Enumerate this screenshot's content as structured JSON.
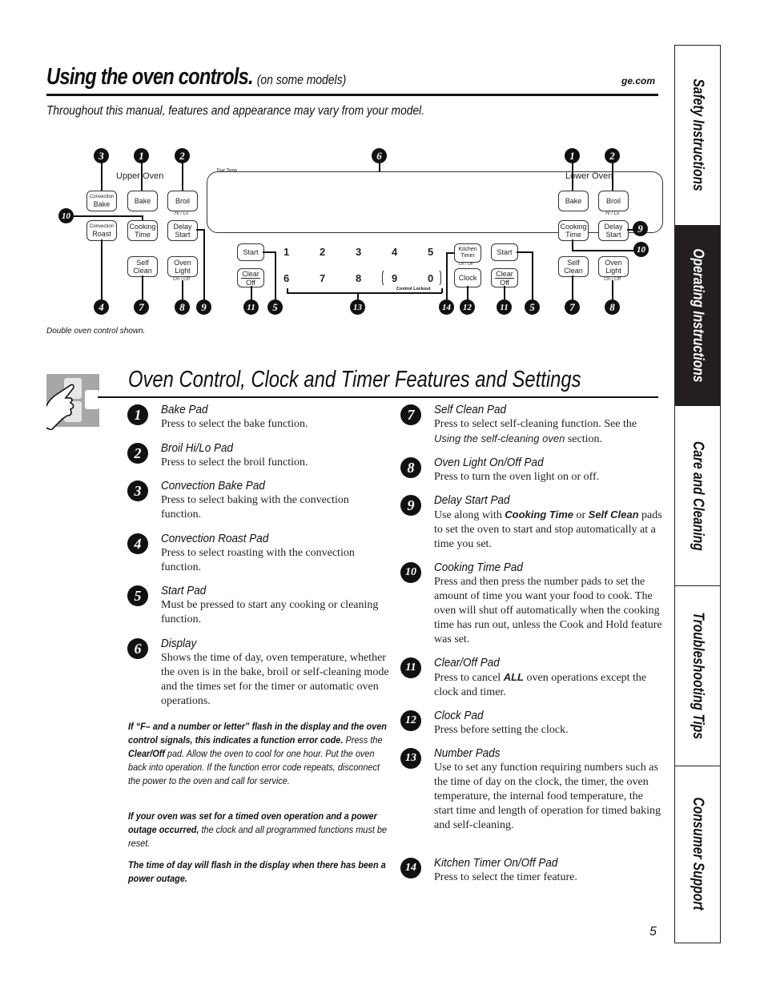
{
  "header": {
    "title": "Using the oven controls.",
    "title_sub": "(on some models)",
    "site": "ge.com",
    "intro": "Throughout this manual, features and appearance may vary from your model."
  },
  "diagram": {
    "upper_oven_label": "Upper Oven",
    "lower_oven_label": "Lower Oven",
    "display_label": "True Temp",
    "control_lockout_label": "Control Lockout",
    "pads": {
      "convection_bake_small": "Convection",
      "convection_bake": "Bake",
      "bake": "Bake",
      "broil": "Broil",
      "broil_sub": "Hi / Lo",
      "convection_roast_small": "Convection",
      "convection_roast": "Roast",
      "cooking_time_1": "Cooking",
      "cooking_time_2": "Time",
      "delay_start_1": "Delay",
      "delay_start_2": "Start",
      "self_clean_1": "Self",
      "self_clean_2": "Clean",
      "oven_light_1": "Oven",
      "oven_light_2": "Light",
      "oven_light_sub": "On / Off",
      "start": "Start",
      "clear": "Clear",
      "off": "Off",
      "kitchen_timer_1": "Kitchen",
      "kitchen_timer_2": "Timer",
      "kitchen_timer_sub": "On / Off",
      "clock": "Clock"
    },
    "number_pads": [
      "1",
      "2",
      "3",
      "4",
      "5",
      "6",
      "7",
      "8",
      "9",
      "0"
    ],
    "callouts": {
      "c1": "1",
      "c2": "2",
      "c3": "3",
      "c4": "4",
      "c5": "5",
      "c6": "6",
      "c7": "7",
      "c8": "8",
      "c9": "9",
      "c10": "10",
      "c11": "11",
      "c12": "12",
      "c13": "13",
      "c14": "14"
    },
    "caption": "Double oven control shown."
  },
  "section": {
    "title": "Oven Control, Clock and Timer Features and Settings"
  },
  "features": [
    {
      "num": "1",
      "title": "Bake Pad",
      "desc": "Press to select the bake function."
    },
    {
      "num": "2",
      "title": "Broil Hi/Lo Pad",
      "desc": "Press to select the broil function."
    },
    {
      "num": "3",
      "title": "Convection Bake Pad",
      "desc": "Press to select baking with the convection function."
    },
    {
      "num": "4",
      "title": "Convection Roast Pad",
      "desc": "Press to select roasting with the convection function."
    },
    {
      "num": "5",
      "title": "Start Pad",
      "desc": "Must be pressed to start any cooking or cleaning function."
    },
    {
      "num": "6",
      "title": "Display",
      "desc": "Shows the time of day, oven temperature, whether the oven is in the bake, broil or self-cleaning mode and the times set for the timer or automatic oven operations."
    },
    {
      "num": "7",
      "title": "Self Clean Pad",
      "desc_pre": "Press to select self-cleaning function. See the ",
      "desc_em": "Using the self-cleaning oven",
      "desc_post": " section."
    },
    {
      "num": "8",
      "title": "Oven Light On/Off Pad",
      "desc": "Press to turn the oven light on or off."
    },
    {
      "num": "9",
      "title": "Delay Start Pad",
      "desc_pre": "Use along with ",
      "desc_b1": "Cooking Time",
      "desc_mid": " or ",
      "desc_b2": "Self Clean",
      "desc_post": " pads to set the oven to start and stop automatically at a time you set."
    },
    {
      "num": "10",
      "title": "Cooking Time Pad",
      "desc": "Press and then press the number pads to set the amount of time you want your food to cook. The oven will shut off automatically when the cooking time has run out, unless the Cook and Hold feature was set."
    },
    {
      "num": "11",
      "title": "Clear/Off Pad",
      "desc_pre": "Press to cancel ",
      "desc_b1": "ALL",
      "desc_post": " oven operations except the clock and timer."
    },
    {
      "num": "12",
      "title": "Clock Pad",
      "desc": "Press before setting the clock."
    },
    {
      "num": "13",
      "title": "Number Pads",
      "desc": "Use to set any function requiring numbers such as the time of day on the clock, the timer, the oven temperature, the internal food temperature, the start time and length of operation for timed baking and self-cleaning."
    },
    {
      "num": "14",
      "title": "Kitchen Timer On/Off Pad",
      "desc": "Press to select the timer feature."
    }
  ],
  "notes": {
    "n1_bold": "If “F– and a number or letter” flash in the display and the oven control signals, this indicates a function error code.",
    "n1_text_a": " Press the ",
    "n1_bold2": "Clear/Off",
    "n1_text_b": " pad. Allow the oven to cool for one hour. Put the oven back into operation. If the function error code repeats, disconnect the power to the oven and call for service.",
    "n2_bold": "If your oven was set for a timed oven operation and a power outage occurred,",
    "n2_text": " the clock and all programmed functions must be reset.",
    "n3_bold": "The time of day will flash in the display when there has been a power outage."
  },
  "side_tabs": [
    {
      "label": "Safety Instructions",
      "active": false
    },
    {
      "label": "Operating Instructions",
      "active": true
    },
    {
      "label": "Care and Cleaning",
      "active": false
    },
    {
      "label": "Troubleshooting Tips",
      "active": false
    },
    {
      "label": "Consumer Support",
      "active": false
    }
  ],
  "page_number": "5"
}
